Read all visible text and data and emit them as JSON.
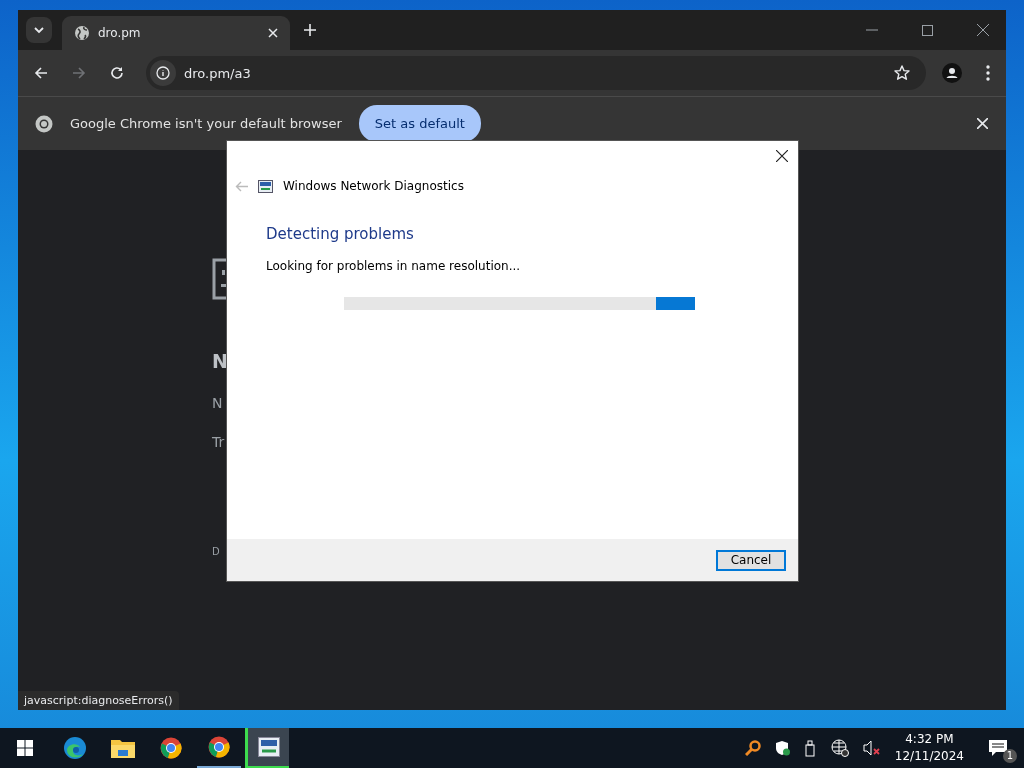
{
  "browser": {
    "tab": {
      "title": "dro.pm"
    },
    "address": "dro.pm/a3",
    "infobar": {
      "message": "Google Chrome isn't your default browser",
      "button": "Set as default"
    },
    "page_text": [
      "N",
      "N",
      "Tr",
      "D"
    ],
    "status_link": "javascript:diagnoseErrors()"
  },
  "dialog": {
    "title": "Windows Network Diagnostics",
    "heading": "Detecting problems",
    "status": "Looking for problems in name resolution...",
    "progress": {
      "kind": "marquee",
      "level": 1
    },
    "buttons": [
      "Cancel"
    ]
  },
  "taskbar": {
    "apps": [
      {
        "kind": "edge",
        "running": false,
        "selected": false
      },
      {
        "kind": "folder",
        "running": false,
        "selected": false
      },
      {
        "kind": "chrome",
        "running": false,
        "selected": false
      },
      {
        "kind": "chrome",
        "running": true,
        "selected": false
      },
      {
        "kind": "diagnostics",
        "running": true,
        "selected": true
      }
    ],
    "tray": {
      "time": "4:32 PM",
      "date": "12/11/2024",
      "notifications": "1"
    }
  }
}
